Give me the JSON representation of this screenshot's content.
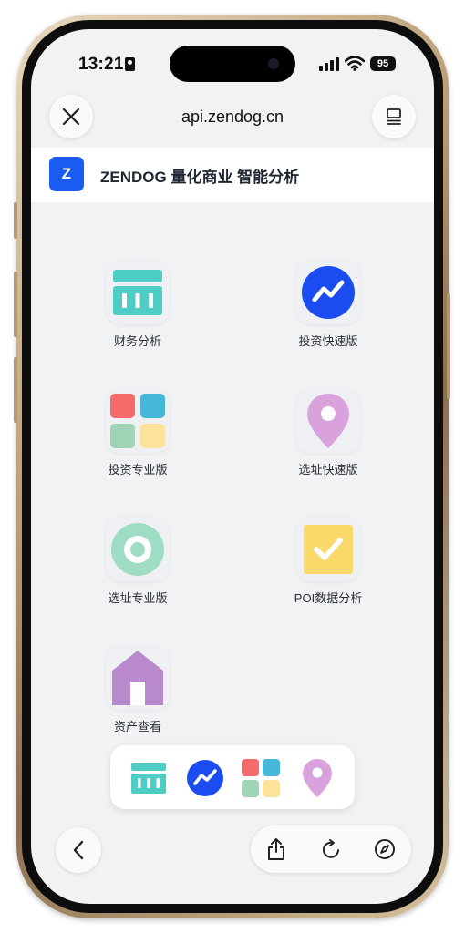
{
  "status_bar": {
    "time": "13:21",
    "battery": "95"
  },
  "navbar": {
    "url": "api.zendog.cn",
    "close_icon": "close-icon",
    "menu_icon": "reader-icon"
  },
  "header": {
    "logo_letter": "Z",
    "brand": "ZENDOG 量化商业 智能分析"
  },
  "apps": [
    {
      "label": "财务分析",
      "icon": "finance-bars-icon"
    },
    {
      "label": "投资快速版",
      "icon": "trend-line-icon"
    },
    {
      "label": "投资专业版",
      "icon": "four-squares-icon"
    },
    {
      "label": "选址快速版",
      "icon": "map-pin-icon"
    },
    {
      "label": "选址专业版",
      "icon": "target-ring-icon"
    },
    {
      "label": "POI数据分析",
      "icon": "checkmark-icon"
    },
    {
      "label": "资产查看",
      "icon": "house-icon"
    }
  ],
  "dock": [
    {
      "icon": "finance-bars-icon"
    },
    {
      "icon": "trend-line-icon"
    },
    {
      "icon": "four-squares-icon"
    },
    {
      "icon": "map-pin-icon"
    }
  ],
  "toolbar": {
    "back_icon": "chevron-left-icon",
    "share_icon": "share-icon",
    "reload_icon": "reload-icon",
    "compass_icon": "compass-icon"
  },
  "colors": {
    "teal": "#4ecdc4",
    "blue": "#1a4cf0",
    "red": "#f56b6b",
    "cyan": "#45b8d8",
    "green": "#9fd4b6",
    "yellow": "#fde39a",
    "purple": "#d9a2dc",
    "ring": "#9edcc4",
    "check_yellow": "#f8d96a",
    "house": "#b989cd"
  }
}
